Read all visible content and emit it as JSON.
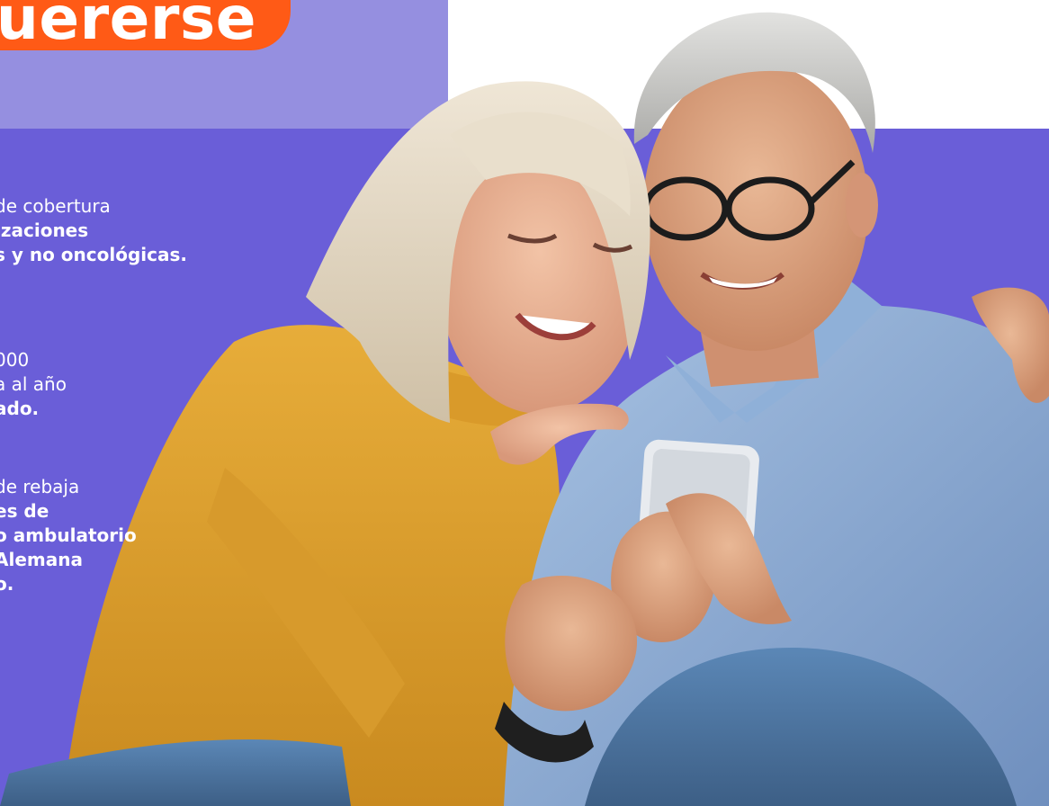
{
  "headline": {
    "text": "uererse"
  },
  "benefits": [
    {
      "lines": [
        {
          "text": "de cobertura",
          "weight": "light"
        },
        {
          "text": "izaciones",
          "weight": "bold"
        },
        {
          "text": "s y no oncológicas.",
          "weight": "bold"
        }
      ]
    },
    {
      "lines": [
        {
          "text": "000",
          "weight": "light"
        },
        {
          "text": "a al año",
          "weight": "light"
        },
        {
          "text": "ado.",
          "weight": "bold"
        }
      ]
    },
    {
      "lines": [
        {
          "text": "de rebaja",
          "weight": "light"
        },
        {
          "text": "es de",
          "weight": "bold"
        },
        {
          "text": "o ambulatorio",
          "weight": "bold"
        },
        {
          "text": "Alemana",
          "weight": "bold"
        },
        {
          "text": "o.",
          "weight": "bold"
        }
      ]
    }
  ],
  "colors": {
    "top_band": "#958fe0",
    "main_band": "#6a5ed8",
    "accent_orange": "#ff5a16",
    "text": "#ffffff"
  },
  "image": {
    "subject": "senior couple smiling looking at a smartphone"
  }
}
